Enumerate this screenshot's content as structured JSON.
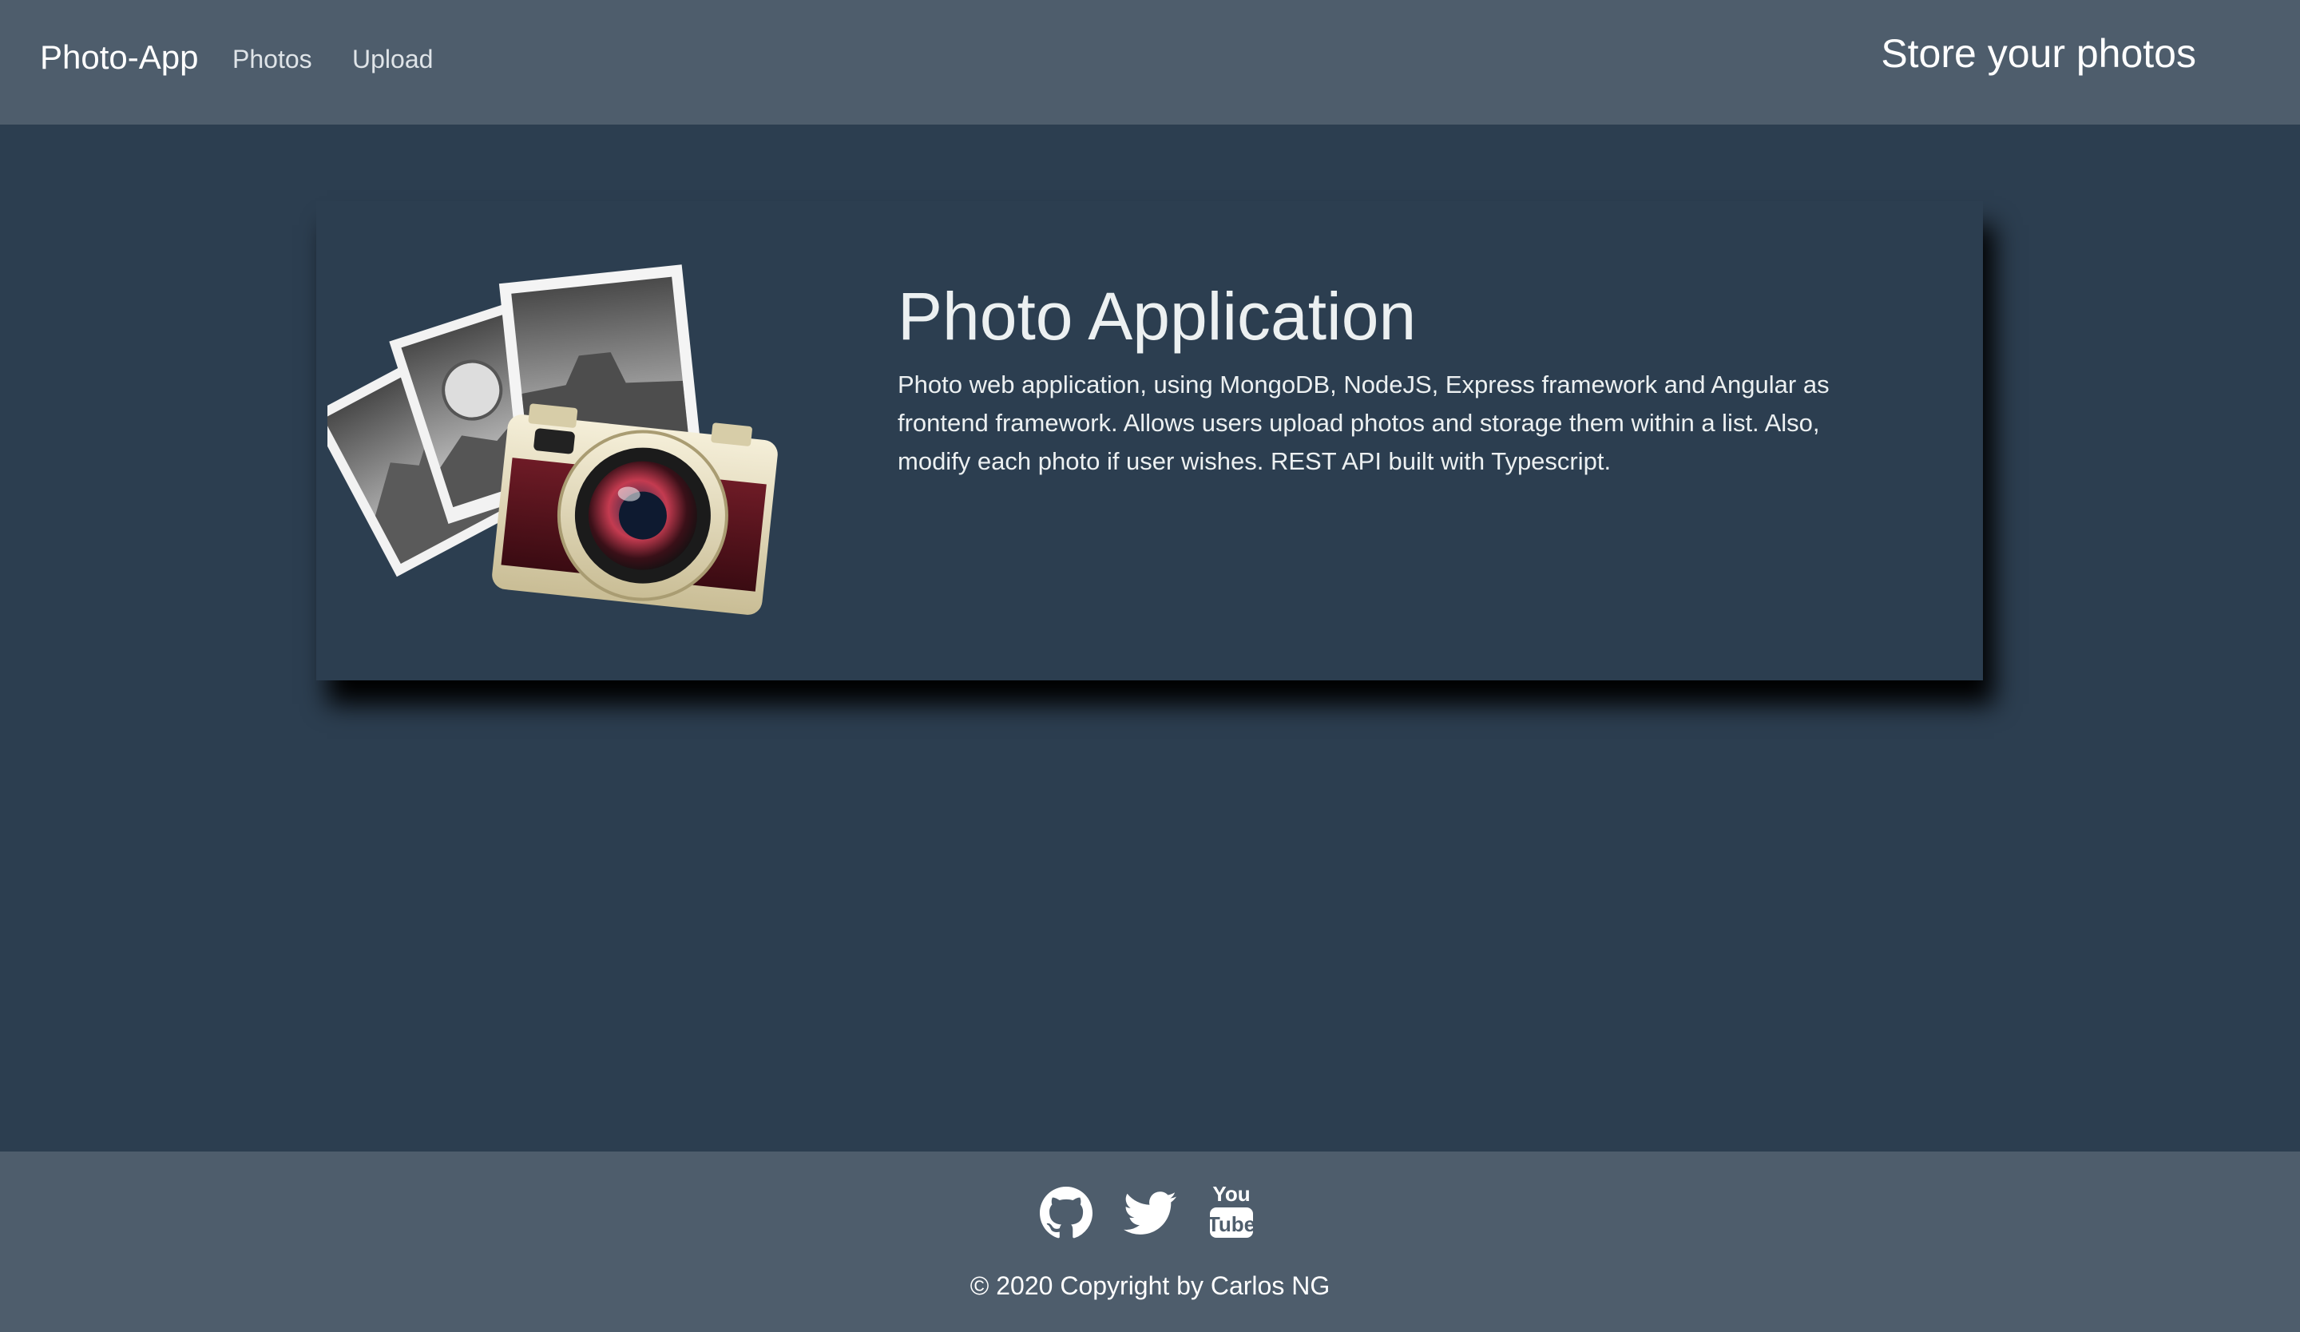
{
  "header": {
    "brand": "Photo-App",
    "nav": [
      "Photos",
      "Upload"
    ],
    "tagline": "Store your photos"
  },
  "card": {
    "title": "Photo Application",
    "description": "Photo web application, using MongoDB, NodeJS, Express framework and Angular as frontend framework. Allows users upload photos and storage them within a list. Also, modify each photo if user wishes. REST API built with Typescript.",
    "image_alt": "camera-with-photos-illustration"
  },
  "footer": {
    "social": [
      "github-icon",
      "twitter-icon",
      "youtube-icon"
    ],
    "youtube_top": "You",
    "youtube_bottom": "Tube",
    "copyright": "© 2020 Copyright by Carlos NG"
  },
  "colors": {
    "navbar": "#4e5d6c",
    "background": "#2c3e50",
    "text": "#ecf0f1"
  }
}
